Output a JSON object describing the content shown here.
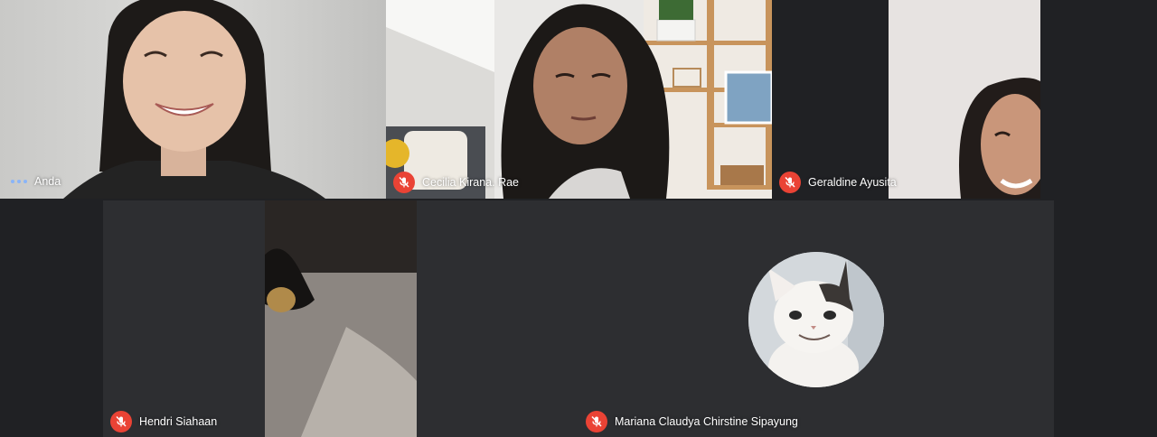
{
  "participants": [
    {
      "name": "Anda",
      "status": "speaking"
    },
    {
      "name": "Cecilia Kirana. Rae",
      "status": "muted"
    },
    {
      "name": "Geraldine Ayusita",
      "status": "muted"
    },
    {
      "name": "Hendri Siahaan",
      "status": "muted"
    },
    {
      "name": "Mariana Claudya Chirstine Sipayung",
      "status": "muted"
    }
  ],
  "icons": {
    "speaking": "audio-dots-icon",
    "muted": "mic-off-icon",
    "avatar": "cat-avatar"
  },
  "colors": {
    "background": "#202124",
    "mic_off": "#ea4335",
    "speaking_dots": "#8ab4f8",
    "name_text": "#ffffff"
  }
}
